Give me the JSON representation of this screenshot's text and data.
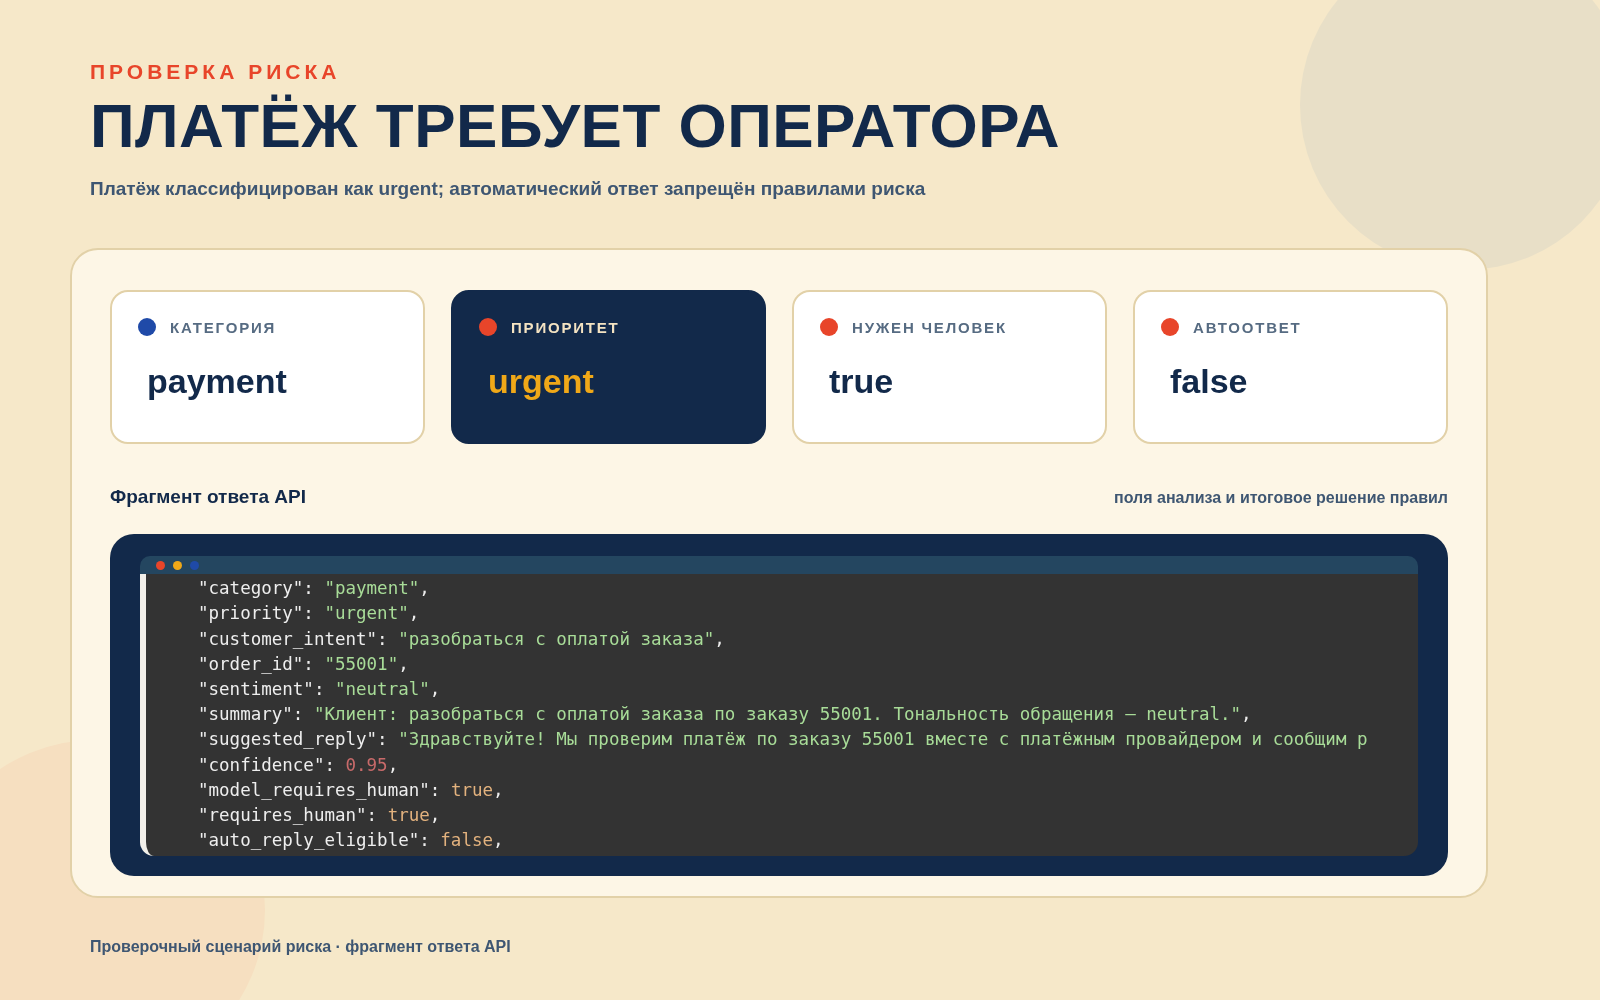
{
  "header": {
    "eyebrow": "ПРОВЕРКА РИСКА",
    "title": "ПЛАТЁЖ ТРЕБУЕТ ОПЕРАТОРА",
    "subtitle": "Платёж классифицирован как urgent; автоматический ответ запрещён правилами риска"
  },
  "cards": [
    {
      "label": "КАТЕГОРИЯ",
      "value": "payment",
      "color": "#1f4aa8",
      "emphasized": false
    },
    {
      "label": "ПРИОРИТЕТ",
      "value": "urgent",
      "color": "#e8452a",
      "emphasized": true
    },
    {
      "label": "НУЖЕН ЧЕЛОВЕК",
      "value": "true",
      "color": "#e8452a",
      "emphasized": false
    },
    {
      "label": "АВТООТВЕТ",
      "value": "false",
      "color": "#e8452a",
      "emphasized": false
    }
  ],
  "section": {
    "title": "Фрагмент ответа API",
    "note": "поля анализа и итоговое решение правил"
  },
  "code": {
    "dots": [
      {
        "color": "#e8452a"
      },
      {
        "color": "#f0a818"
      },
      {
        "color": "#1f4aa8"
      }
    ],
    "lines": [
      {
        "key": "\"category\": ",
        "value": "\"payment\"",
        "kind": "string",
        "tail": ","
      },
      {
        "key": "\"priority\": ",
        "value": "\"urgent\"",
        "kind": "string",
        "tail": ","
      },
      {
        "key": "\"customer_intent\": ",
        "value": "\"разобраться с оплатой заказа\"",
        "kind": "string",
        "tail": ","
      },
      {
        "key": "\"order_id\": ",
        "value": "\"55001\"",
        "kind": "string",
        "tail": ","
      },
      {
        "key": "\"sentiment\": ",
        "value": "\"neutral\"",
        "kind": "string",
        "tail": ","
      },
      {
        "key": "\"summary\": ",
        "value": "\"Клиент: разобраться с оплатой заказа по заказу 55001. Тональность обращения — neutral.\"",
        "kind": "string",
        "tail": ","
      },
      {
        "key": "\"suggested_reply\": ",
        "value": "\"Здравствуйте! Мы проверим платёж по заказу 55001 вместе с платёжным провайдером и сообщим р",
        "kind": "string"
      },
      {
        "key": "\"confidence\": ",
        "value": "0.95",
        "kind": "number",
        "tail": ","
      },
      {
        "key": "\"model_requires_human\": ",
        "value": "true",
        "kind": "boolean",
        "tail": ","
      },
      {
        "key": "\"requires_human\": ",
        "value": "true",
        "kind": "boolean",
        "tail": ","
      },
      {
        "key": "\"auto_reply_eligible\": ",
        "value": "false",
        "kind": "boolean",
        "tail": ","
      }
    ]
  },
  "footer": "Проверочный сценарий риска · фрагмент ответа API"
}
